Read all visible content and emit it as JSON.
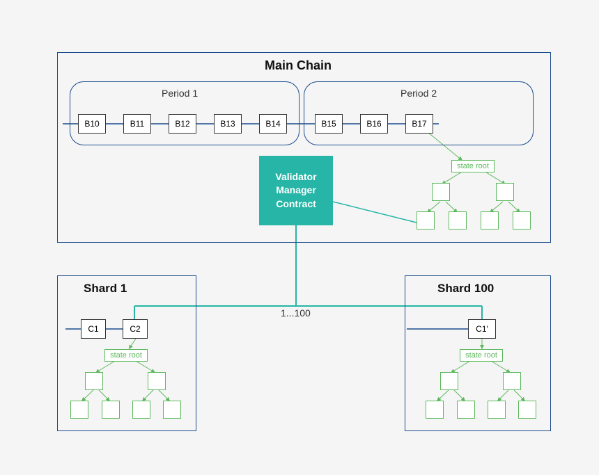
{
  "main_chain": {
    "title": "Main Chain",
    "periods": [
      {
        "label": "Period 1",
        "blocks": [
          "B10",
          "B11",
          "B12",
          "B13",
          "B14"
        ]
      },
      {
        "label": "Period 2",
        "blocks": [
          "B15",
          "B16",
          "B17"
        ]
      }
    ],
    "validator": {
      "line1": "Validator",
      "line2": "Manager",
      "line3": "Contract"
    },
    "state_root_label": "state root"
  },
  "shards": {
    "connector_label": "1...100",
    "shard1": {
      "title": "Shard 1",
      "blocks": [
        "C1",
        "C2"
      ],
      "state_root_label": "state root"
    },
    "shard100": {
      "title": "Shard 100",
      "blocks": [
        "C1'"
      ],
      "state_root_label": "state root"
    }
  },
  "colors": {
    "blue": "#1a4b8c",
    "teal": "#26b5a6",
    "green": "#5cb85c"
  }
}
